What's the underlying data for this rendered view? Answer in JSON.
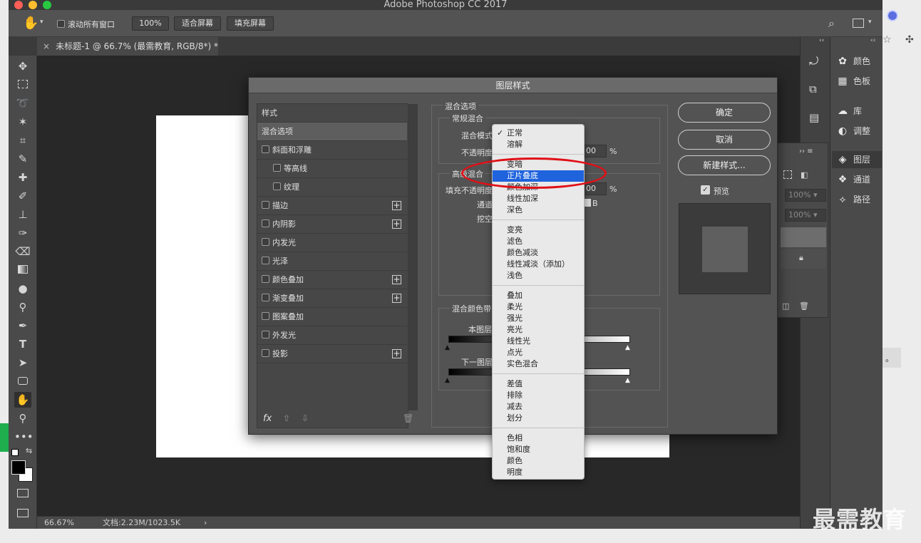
{
  "app": {
    "window_title": "Adobe Photoshop CC 2017"
  },
  "options_bar": {
    "scroll_all_windows": "滚动所有窗口",
    "zoom_100": "100%",
    "fit_screen": "适合屏幕",
    "fill_screen": "填充屏幕"
  },
  "document_tab": {
    "label": "未标题-1 @ 66.7% (最需教育, RGB/8*) *"
  },
  "status_bar": {
    "zoom": "66.67%",
    "doc_size": "文档:2.23M/1023.5K"
  },
  "right_panels": {
    "items": [
      "颜色",
      "色板",
      "库",
      "调整",
      "图层",
      "通道",
      "路径"
    ],
    "opacity_1": "100%",
    "opacity_2": "100%"
  },
  "dialog": {
    "title": "图层样式",
    "styles_header": "样式",
    "style_items": [
      {
        "label": "混合选项",
        "checkbox": false,
        "plus": false
      },
      {
        "label": "斜面和浮雕",
        "checkbox": true,
        "plus": false
      },
      {
        "label": "等高线",
        "checkbox": true,
        "plus": false
      },
      {
        "label": "纹理",
        "checkbox": true,
        "plus": false
      },
      {
        "label": "描边",
        "checkbox": true,
        "plus": true
      },
      {
        "label": "内阴影",
        "checkbox": true,
        "plus": true
      },
      {
        "label": "内发光",
        "checkbox": true,
        "plus": false
      },
      {
        "label": "光泽",
        "checkbox": true,
        "plus": false
      },
      {
        "label": "颜色叠加",
        "checkbox": true,
        "plus": true
      },
      {
        "label": "渐变叠加",
        "checkbox": true,
        "plus": true
      },
      {
        "label": "图案叠加",
        "checkbox": true,
        "plus": false
      },
      {
        "label": "外发光",
        "checkbox": true,
        "plus": false
      },
      {
        "label": "投影",
        "checkbox": true,
        "plus": true
      }
    ],
    "fx_label": "fx",
    "blend_options_title": "混合选项",
    "general_blending": "常规混合",
    "blend_mode_label": "混合模式",
    "opacity_label": "不透明度",
    "opacity_value": "00",
    "percent": "%",
    "advanced_blending": "高级混合",
    "fill_opacity_label": "填充不透明度",
    "fill_opacity_value": "00",
    "channels_label": "通道",
    "channel_b": "B",
    "knockout_label": "挖空",
    "blend_if_title": "混合颜色带",
    "this_layer": "本图层",
    "underlying_layer": "下一图层",
    "buttons": {
      "ok": "确定",
      "cancel": "取消",
      "new_style": "新建样式...",
      "preview": "预览"
    }
  },
  "blend_menu": {
    "checkmark": "✓",
    "groups": [
      [
        "正常",
        "溶解"
      ],
      [
        "变暗",
        "正片叠底",
        "颜色加深",
        "线性加深",
        "深色"
      ],
      [
        "变亮",
        "滤色",
        "颜色减淡",
        "线性减淡（添加）",
        "浅色"
      ],
      [
        "叠加",
        "柔光",
        "强光",
        "亮光",
        "线性光",
        "点光",
        "实色混合"
      ],
      [
        "差值",
        "排除",
        "减去",
        "划分"
      ],
      [
        "色相",
        "饱和度",
        "颜色",
        "明度"
      ]
    ],
    "highlighted": "正片叠底",
    "selected": "正常"
  },
  "watermark": "最需教育",
  "browser_edge": {
    "period": "。"
  },
  "colors": {
    "highlight_blue": "#1f63dd",
    "annotation_red": "#e00f16"
  }
}
